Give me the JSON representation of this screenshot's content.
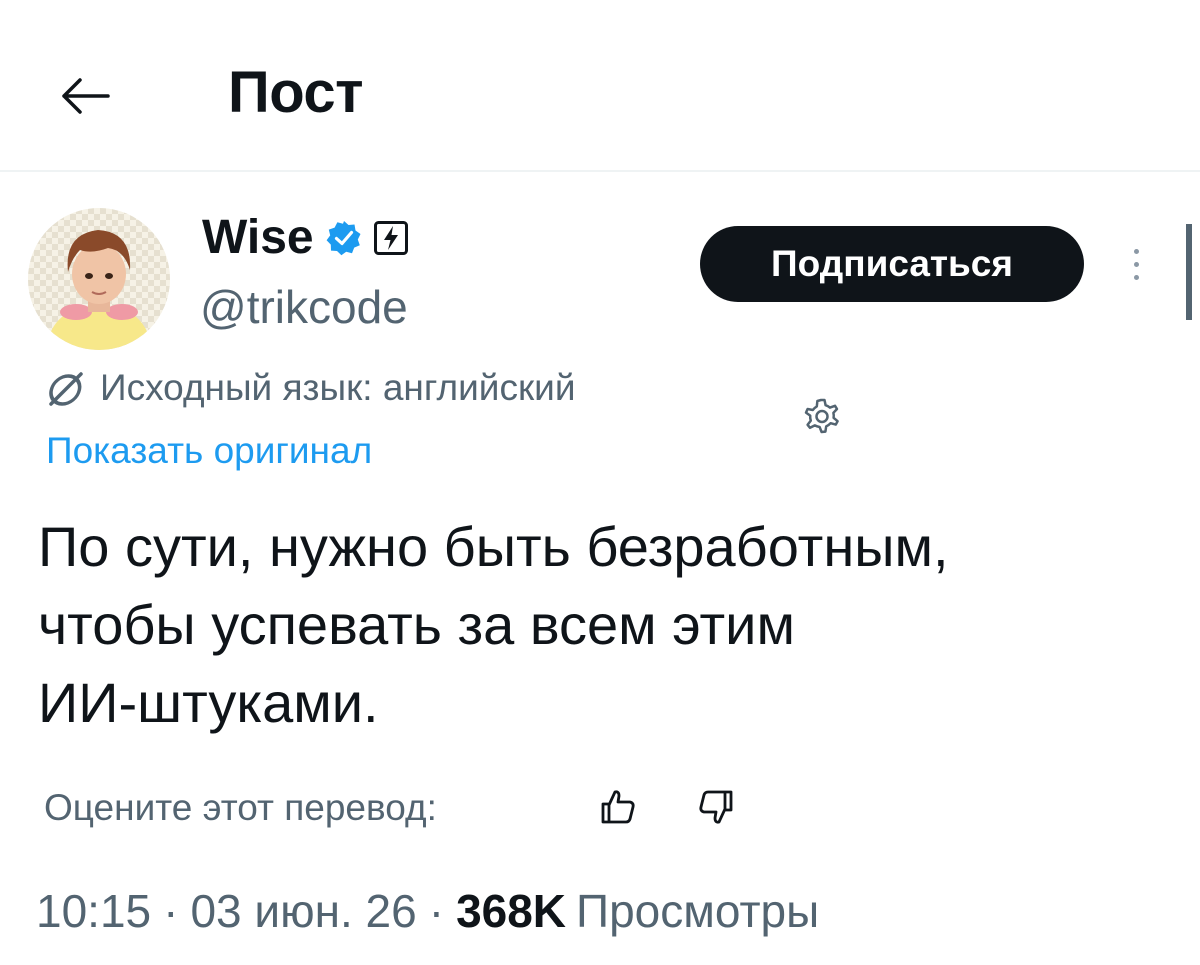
{
  "header": {
    "title": "Пост",
    "back_icon": "arrow-left-icon"
  },
  "author": {
    "name": "Wise",
    "handle": "@trikcode",
    "verified_icon": "verified-badge-icon",
    "badge_icon": "lightning-badge-icon",
    "avatar": "cartoon-avatar"
  },
  "actions": {
    "follow_label": "Подписаться",
    "more_icon": "more-vertical-icon"
  },
  "translation": {
    "note": "Исходный язык: английский",
    "note_icon": "translate-icon",
    "show_original": "Показать оригинал",
    "settings_icon": "gear-icon",
    "rate_label": "Оцените этот перевод:",
    "thumbs_up_icon": "thumbs-up-icon",
    "thumbs_down_icon": "thumbs-down-icon"
  },
  "post": {
    "lines": [
      "По сути, нужно быть безработным,",
      "чтобы успевать за всем этим",
      "ИИ-штуками."
    ]
  },
  "meta": {
    "time": "10:15",
    "date": "03 июн. 26",
    "separator": "·",
    "views_count": "368K",
    "views_label": "Просмотры"
  },
  "colors": {
    "text": "#0f1419",
    "secondary": "#536471",
    "link": "#1d9bf0",
    "verified": "#1d9bf0",
    "follow_bg": "#0f1419"
  }
}
